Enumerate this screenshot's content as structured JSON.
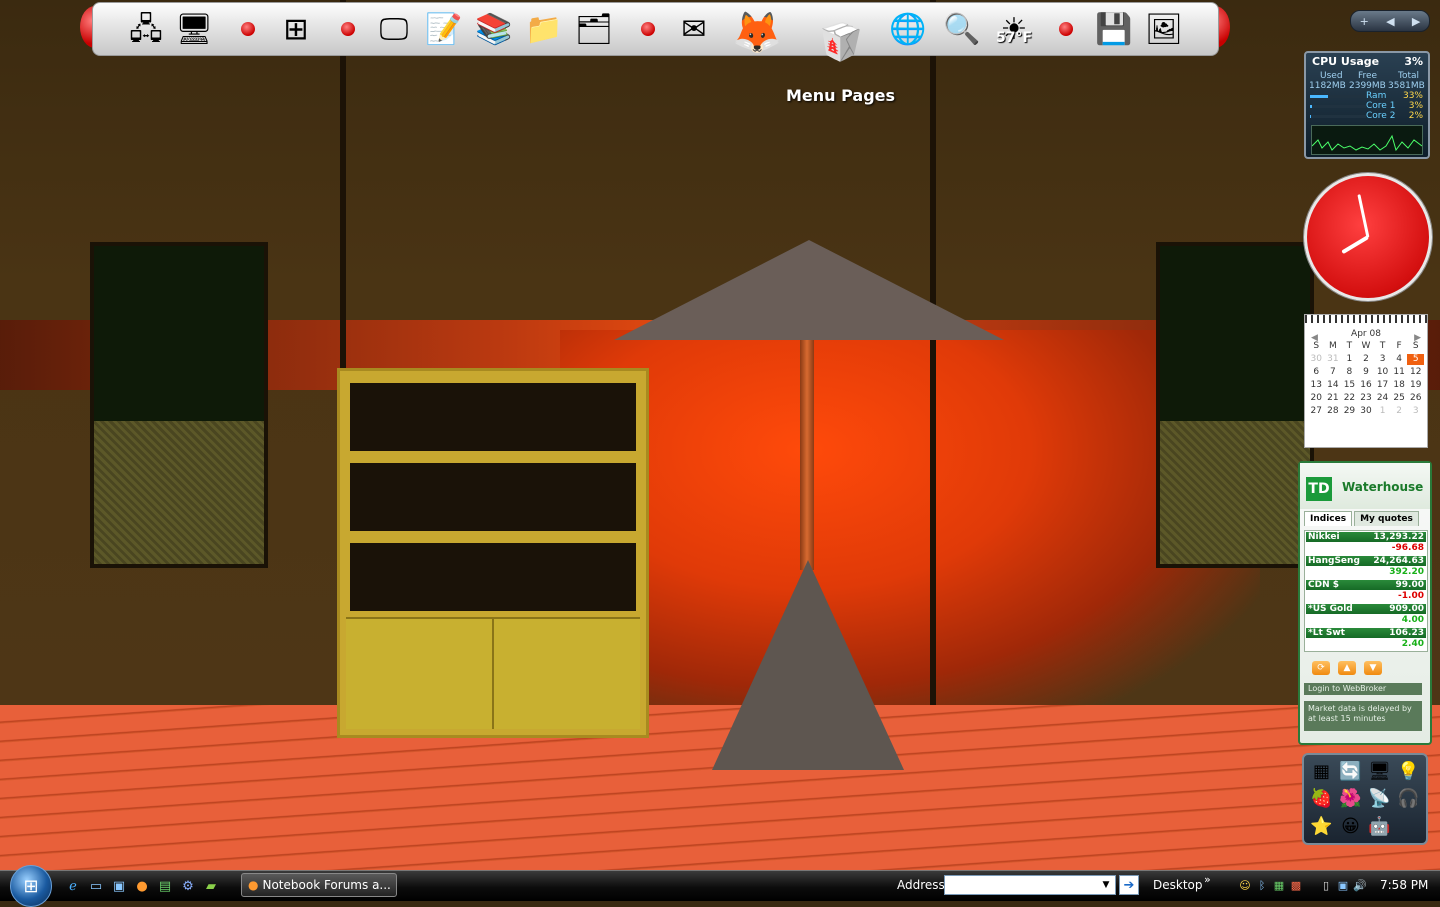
{
  "dock": {
    "items": [
      "network-icon",
      "computer-icon",
      "windows-icon",
      "monitor-icon",
      "notepad-icon",
      "documents-icon",
      "folder-favorites-icon",
      "files-icon",
      "thunderbird-icon",
      "firefox-icon",
      "menu-pages-icon",
      "wikipedia-icon",
      "search-icon",
      "weather-icon",
      "drive-icon",
      "display-icon"
    ],
    "hover_label": "Menu Pages",
    "weather_temp": "57°F"
  },
  "sidebar": {
    "controls": [
      "+",
      "◀",
      "▶"
    ],
    "cpu": {
      "title": "CPU Usage",
      "percent": "3%",
      "labels": [
        "Used",
        "Free",
        "Total"
      ],
      "values": [
        "1182MB",
        "2399MB",
        "3581MB"
      ],
      "meters": [
        {
          "name": "Ram",
          "value": "33%",
          "fill": 0.33
        },
        {
          "name": "Core 1",
          "value": "3%",
          "fill": 0.03
        },
        {
          "name": "Core 2",
          "value": "2%",
          "fill": 0.02
        }
      ]
    },
    "clock": {
      "hour": 7,
      "minute": 58
    },
    "calendar": {
      "month": "Apr 08",
      "nav_prev": "◀",
      "nav_next": "▶",
      "weekdays": [
        "S",
        "M",
        "T",
        "W",
        "T",
        "F",
        "S"
      ],
      "weeks": [
        [
          "30",
          "31",
          "1",
          "2",
          "3",
          "4",
          "5"
        ],
        [
          "6",
          "7",
          "8",
          "9",
          "10",
          "11",
          "12"
        ],
        [
          "13",
          "14",
          "15",
          "16",
          "17",
          "18",
          "19"
        ],
        [
          "20",
          "21",
          "22",
          "23",
          "24",
          "25",
          "26"
        ],
        [
          "27",
          "28",
          "29",
          "30",
          "1",
          "2",
          "3"
        ]
      ],
      "today": "5"
    },
    "td": {
      "logo": "TD",
      "brand": "Waterhouse",
      "tabs": [
        "Indices",
        "My quotes"
      ],
      "quotes": [
        {
          "name": "Nikkei",
          "value": "13,293.22",
          "change": "-96.68",
          "dir": "down"
        },
        {
          "name": "HangSeng",
          "value": "24,264.63",
          "change": "392.20",
          "dir": "up"
        },
        {
          "name": "CDN $",
          "value": "99.00",
          "change": "-1.00",
          "dir": "down"
        },
        {
          "name": "*US Gold",
          "value": "909.00",
          "change": "4.00",
          "dir": "up"
        },
        {
          "name": "*Lt Swt",
          "value": "106.23",
          "change": "2.40",
          "dir": "up"
        }
      ],
      "login": "Login to WebBroker",
      "note": "Market data is delayed by at least 15 minutes"
    }
  },
  "taskbar": {
    "task_label": "Notebook Forums a...",
    "address_label": "Address",
    "address_value": "",
    "desktop_label": "Desktop",
    "chevron": "»",
    "time": "7:58 PM"
  }
}
